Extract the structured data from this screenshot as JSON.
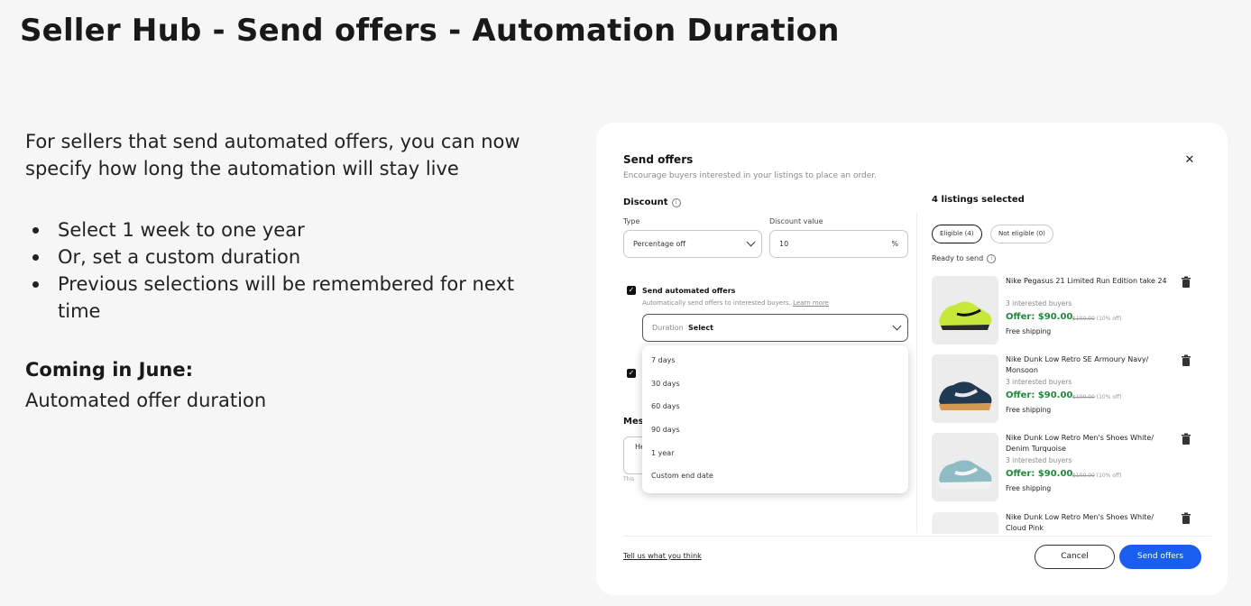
{
  "slide": {
    "title": "Seller Hub - Send offers - Automation Duration",
    "intro": "For sellers that send automated offers, you can now specify how long the automation will stay live",
    "bullets": [
      "Select 1 week to one year",
      "Or, set a custom duration",
      "Previous selections will be remembered for next time"
    ],
    "coming_heading": "Coming in June:",
    "coming_text": "Automated offer duration"
  },
  "modal": {
    "title": "Send offers",
    "subtitle": "Encourage buyers interested in your listings to place an order.",
    "close_icon": "close-icon",
    "discount": {
      "label": "Discount",
      "type_label": "Type",
      "type_value": "Percentage off",
      "value_label": "Discount value",
      "value": "10",
      "unit": "%"
    },
    "automated": {
      "checked": true,
      "label": "Send automated offers",
      "helper": "Automatically send offers to interested buyers.",
      "learn_more": "Learn more",
      "duration_label": "Duration",
      "duration_value": "Select",
      "options": [
        "7 days",
        "30 days",
        "60 days",
        "90 days",
        "1 year",
        "Custom end date"
      ]
    },
    "message": {
      "label": "Mes",
      "value": "He",
      "note": "This"
    },
    "listings": {
      "title": "4 listings selected",
      "chip_eligible": "Eligible (4)",
      "chip_not_eligible": "Not eligible (0)",
      "ready_label": "Ready to send",
      "items": [
        {
          "name": "Nike Pegasus 21 Limited Run Edition take 24",
          "buyers": "3 interested buyers",
          "offer": "Offer: $90.00",
          "original": "$100.00",
          "discount": "(10% off)",
          "shipping": "Free shipping"
        },
        {
          "name": "Nike Dunk Low Retro SE Armoury Navy/ Monsoon",
          "buyers": "3 interested buyers",
          "offer": "Offer: $90.00",
          "original": "$100.00",
          "discount": "(10% off)",
          "shipping": "Free shipping"
        },
        {
          "name": "Nike Dunk Low Retro Men's Shoes White/ Denim Turquoise",
          "buyers": "3 interested buyers",
          "offer": "Offer: $90.00",
          "original": "$100.00",
          "discount": "(10% off)",
          "shipping": "Free shipping"
        },
        {
          "name": "Nike Dunk Low Retro Men's Shoes White/ Cloud Pink"
        }
      ]
    },
    "footer": {
      "feedback": "Tell us what you think",
      "cancel": "Cancel",
      "send": "Send offers"
    }
  },
  "colors": {
    "accent": "#1a5ef0",
    "offer_green": "#1e8a3a",
    "text": "#191919",
    "background": "#f6f6f6"
  }
}
